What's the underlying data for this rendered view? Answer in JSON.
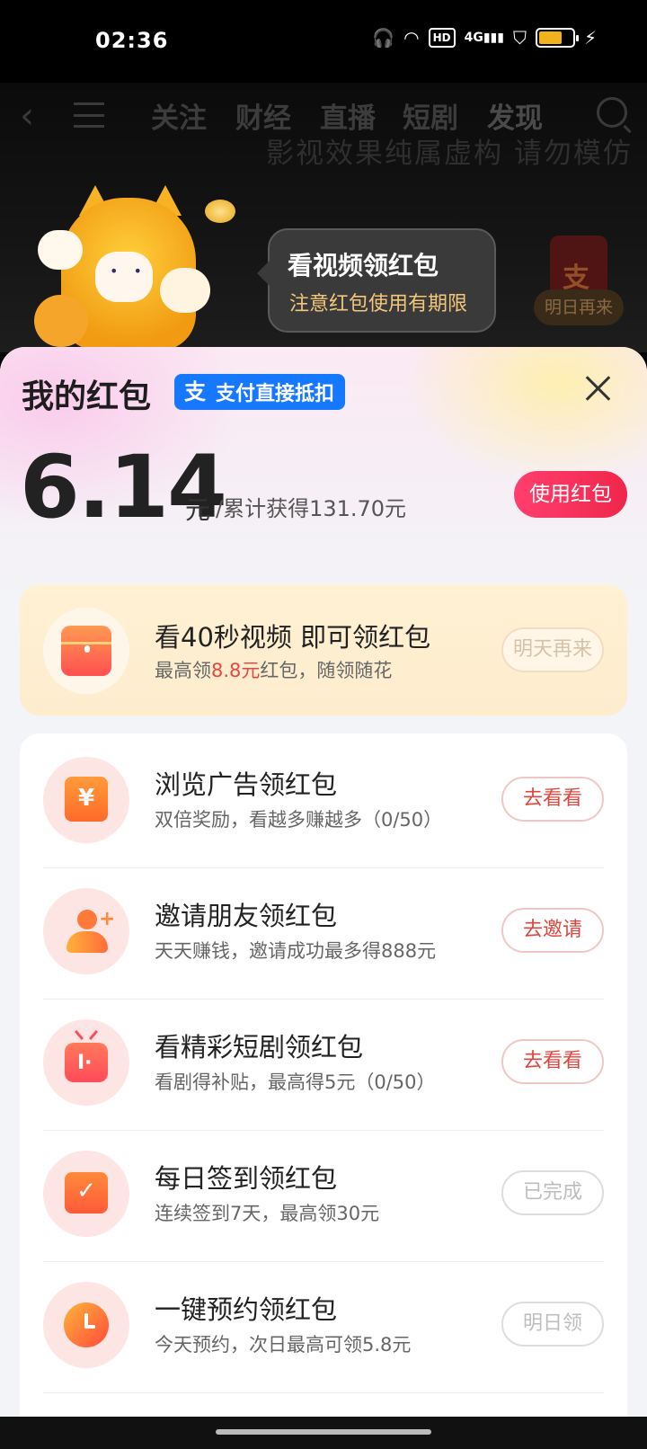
{
  "status_bar": {
    "time": "02:36",
    "hd_label": "HD",
    "network": "4G"
  },
  "top_nav": {
    "tabs": [
      {
        "label": "关注"
      },
      {
        "label": "财经"
      },
      {
        "label": "直播"
      },
      {
        "label": "短剧"
      },
      {
        "label": "发现",
        "active": true
      }
    ],
    "disclaimer": "影视效果纯属虚构 请勿模仿"
  },
  "side_card": {
    "char": "支",
    "chip_label": "明日再来"
  },
  "promo_bubble": {
    "title": "看视频领红包",
    "subtitle": "注意红包使用有期限"
  },
  "sheet": {
    "title": "我的红包",
    "badge_label": "支付直接抵扣",
    "badge_icon": "支",
    "balance": "6.14",
    "balance_unit": "元",
    "total_earned": "/累计获得131.70元",
    "use_button": "使用红包"
  },
  "video_task": {
    "title": "看40秒视频 即可领红包",
    "sub_prefix": "最高领",
    "sub_highlight": "8.8元",
    "sub_suffix": "红包，随领随花",
    "button": "明天再来"
  },
  "tasks": [
    {
      "title": "浏览广告领红包",
      "subtitle": "双倍奖励，看越多赚越多（0/50）",
      "button": "去看看",
      "icon": "yen-icon",
      "glyph": "¥"
    },
    {
      "title": "邀请朋友领红包",
      "subtitle": "天天赚钱，邀请成功最多得888元",
      "button": "去邀请",
      "icon": "invite-person-icon",
      "glyph": "+"
    },
    {
      "title": "看精彩短剧领红包",
      "subtitle": "看剧得补贴，最高得5元（0/50）",
      "button": "去看看",
      "icon": "tv-icon",
      "glyph": "I·"
    },
    {
      "title": "每日签到领红包",
      "subtitle": "连续签到7天，最高领30元",
      "button": "已完成",
      "icon": "calendar-check-icon",
      "glyph": "✓"
    },
    {
      "title": "一键预约领红包",
      "subtitle": "今天预约，次日最高可领5.8元",
      "button": "明日领",
      "icon": "clock-icon",
      "glyph": ""
    }
  ],
  "colors": {
    "accent": "#f0264b",
    "alipay_blue": "#1677ff",
    "highlight_red": "#e8463f"
  }
}
